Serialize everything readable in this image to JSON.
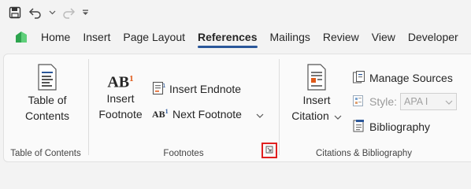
{
  "quick_access": {
    "items": [
      {
        "icon": "save-icon"
      },
      {
        "icon": "undo-icon"
      },
      {
        "icon": "redo-icon"
      },
      {
        "icon": "customize-icon"
      }
    ]
  },
  "tabs": [
    {
      "label": "Home"
    },
    {
      "label": "Insert"
    },
    {
      "label": "Page Layout"
    },
    {
      "label": "References",
      "active": true
    },
    {
      "label": "Mailings"
    },
    {
      "label": "Review"
    },
    {
      "label": "View"
    },
    {
      "label": "Developer"
    }
  ],
  "groups": {
    "toc": {
      "label": "Table of Contents",
      "button_line1": "Table of",
      "button_line2": "Contents"
    },
    "footnotes": {
      "label": "Footnotes",
      "insert_footnote_line1": "Insert",
      "insert_footnote_line2": "Footnote",
      "ab_glyph": "AB",
      "ab_super": "1",
      "insert_endnote": "Insert Endnote",
      "next_footnote": "Next Footnote"
    },
    "citations": {
      "label": "Citations & Bibliography",
      "insert_citation_line1": "Insert",
      "insert_citation_line2": "Citation",
      "manage_sources": "Manage Sources",
      "style_label": "Style:",
      "style_value": "APA I",
      "bibliography": "Bibliography"
    }
  },
  "colors": {
    "accent": "#2b579a",
    "launcher_highlight": "#e02020",
    "logo_green": "#2da44e"
  }
}
